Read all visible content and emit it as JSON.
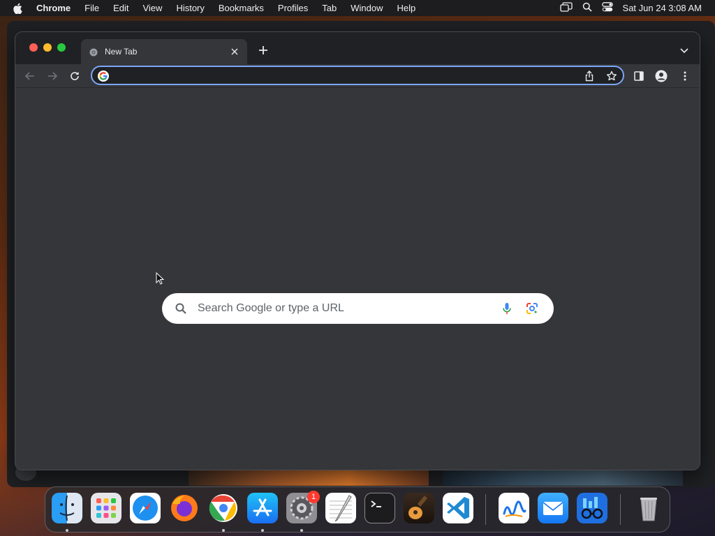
{
  "menubar": {
    "app_name": "Chrome",
    "items": [
      "File",
      "Edit",
      "View",
      "History",
      "Bookmarks",
      "Profiles",
      "Tab",
      "Window",
      "Help"
    ],
    "clock": "Sat Jun 24  3:08 AM"
  },
  "browser": {
    "tab": {
      "title": "New Tab"
    },
    "omnibox": {
      "value": ""
    }
  },
  "newtab_page": {
    "search_placeholder": "Search Google or type a URL"
  },
  "dock": {
    "items": [
      "finder",
      "launchpad",
      "safari",
      "firefox",
      "chrome",
      "app-store",
      "system-settings",
      "textedit",
      "terminal",
      "garageband",
      "vscode",
      "freeform",
      "mail",
      "glasses-app",
      "trash"
    ],
    "settings_badge": "1"
  },
  "colors": {
    "omnibox_focus": "#7ca6f8",
    "content_bg": "#35363a",
    "tabstrip_bg": "#202124"
  }
}
